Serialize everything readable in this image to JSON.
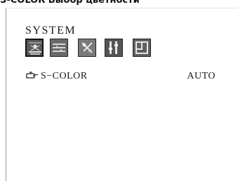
{
  "heading": "S-COLOR Выбор цветности",
  "osd": {
    "menu_title": "SYSTEM",
    "icons": [
      {
        "name": "picture-icon",
        "selected": true
      },
      {
        "name": "geometry-icon",
        "selected": false
      },
      {
        "name": "color-icon",
        "selected": false
      },
      {
        "name": "tools-icon",
        "selected": false
      },
      {
        "name": "position-icon",
        "selected": false
      }
    ],
    "setting": {
      "pointer_icon": "hand-pointer-icon",
      "label": "S−COLOR",
      "value": "AUTO"
    }
  }
}
